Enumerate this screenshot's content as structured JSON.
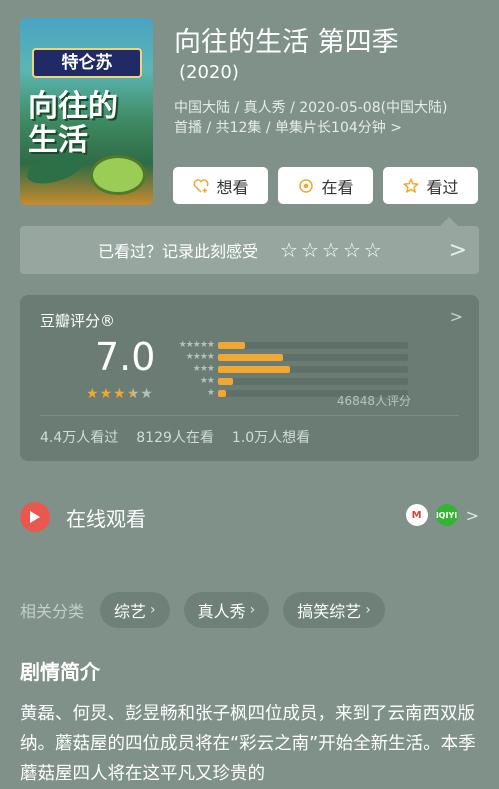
{
  "poster": {
    "banner_text": "特仑苏",
    "title_art": "向往的生活"
  },
  "show": {
    "title": "向往的生活 第四季",
    "year": "(2020)",
    "meta_line1": "中国大陆 / 真人秀 / 2020-05-08(中国大陆)",
    "meta_line2": "首播 / 共12集 / 单集片长104分钟",
    "meta_chevron": ">"
  },
  "actions": [
    {
      "label": "想看",
      "icon": "heart-plus-icon"
    },
    {
      "label": "在看",
      "icon": "circle-dot-icon"
    },
    {
      "label": "看过",
      "icon": "star-outline-icon"
    }
  ],
  "rate_prompt": {
    "text": "已看过？记录此刻感受",
    "star_count": 5,
    "chevron": ">"
  },
  "score": {
    "label": "豆瓣评分®",
    "value": "7.0",
    "stars_rating_of_5": 3.5,
    "distribution_percent": {
      "5": 14,
      "4": 34,
      "3": 38,
      "2": 8,
      "1": 4
    },
    "rating_count": "46848人评分",
    "stats": [
      "4.4万人看过",
      "8129人在看",
      "1.0万人想看"
    ],
    "chevron": ">"
  },
  "online": {
    "label": "在线观看",
    "platforms": [
      "mgtv",
      "iqiyi"
    ],
    "mg_logo_text": "M",
    "iq_logo_text": "iQIYI",
    "chevron": ">"
  },
  "categories": {
    "label": "相关分类",
    "items": [
      "综艺",
      "真人秀",
      "搞笑综艺"
    ]
  },
  "synopsis": {
    "title": "剧情简介",
    "text": "黄磊、何炅、彭昱畅和张子枫四位成员，来到了云南西双版纳。蘑菇屋的四位成员将在“彩云之南”开始全新生活。本季蘑菇屋四人将在这平凡又珍贵的"
  },
  "colors": {
    "background": "#7f9189",
    "accent_star": "#f0a830",
    "play_red": "#e9584f"
  }
}
